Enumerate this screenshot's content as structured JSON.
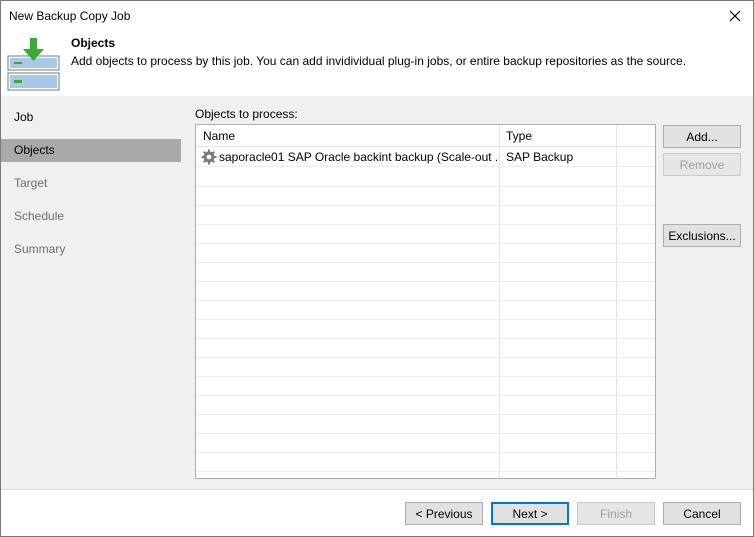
{
  "window": {
    "title": "New Backup Copy Job"
  },
  "header": {
    "title": "Objects",
    "description": "Add objects to process by this job. You can add invidividual plug-in jobs, or entire backup repositories as the source."
  },
  "sidebar": {
    "items": [
      {
        "label": "Job"
      },
      {
        "label": "Objects"
      },
      {
        "label": "Target"
      },
      {
        "label": "Schedule"
      },
      {
        "label": "Summary"
      }
    ],
    "active": "Objects"
  },
  "objects": {
    "label": "Objects to process:",
    "columns": {
      "name": "Name",
      "type": "Type"
    },
    "rows": [
      {
        "name": "saporacle01 SAP Oracle backint backup (Scale-out ...",
        "type": "SAP Backup",
        "icon": "gear-icon"
      }
    ]
  },
  "actions": {
    "add": "Add...",
    "remove": "Remove",
    "exclusions": "Exclusions..."
  },
  "footer": {
    "previous": "< Previous",
    "next": "Next >",
    "finish": "Finish",
    "cancel": "Cancel"
  },
  "colors": {
    "accent": "#0078d7",
    "sidebar_bg": "#f0f0f0",
    "active_item": "#a9a9a9",
    "logo_green": "#3aaa35"
  }
}
